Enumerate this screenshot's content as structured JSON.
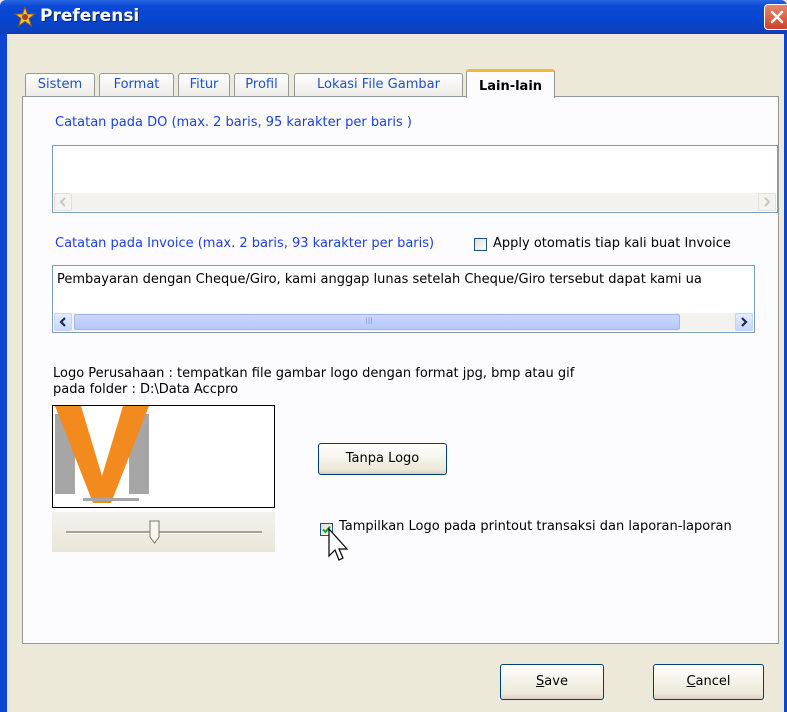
{
  "window": {
    "title": "Preferensi",
    "icon": "app-star-icon",
    "close_icon": "close-icon"
  },
  "tabs": [
    {
      "label": "Sistem",
      "active": false
    },
    {
      "label": "Format",
      "active": false
    },
    {
      "label": "Fitur",
      "active": false
    },
    {
      "label": "Profil",
      "active": false
    },
    {
      "label": "Lokasi File Gambar",
      "active": false
    },
    {
      "label": "Lain-lain",
      "active": true
    }
  ],
  "do_note": {
    "label": "Catatan pada DO (max. 2 baris, 95 karakter per baris )",
    "value": ""
  },
  "invoice_note": {
    "label": "Catatan pada Invoice (max. 2 baris, 93 karakter per baris)",
    "auto_apply_label": "Apply otomatis tiap kali buat Invoice",
    "auto_apply_checked": false,
    "value": "Pembayaran dengan Cheque/Giro, kami anggap lunas setelah Cheque/Giro tersebut dapat kami ua",
    "scroll_thumb_glyph": "III"
  },
  "logo": {
    "hint_line1": "Logo Perusahaan : tempatkan file gambar logo dengan format jpg, bmp atau gif",
    "hint_line2": "pada folder : D:\\Data Accpro",
    "no_logo_button": "Tanpa Logo",
    "show_logo_label": "Tampilkan Logo pada printout transaksi dan laporan-laporan",
    "show_logo_checked": true,
    "size_slider_value": 0.45,
    "colors": {
      "orange": "#f28a1e",
      "gray": "#a6a6a6"
    }
  },
  "footer": {
    "save_label_accel": "S",
    "save_label_rest": "ave",
    "cancel_label_accel": "C",
    "cancel_label_rest": "ancel"
  }
}
